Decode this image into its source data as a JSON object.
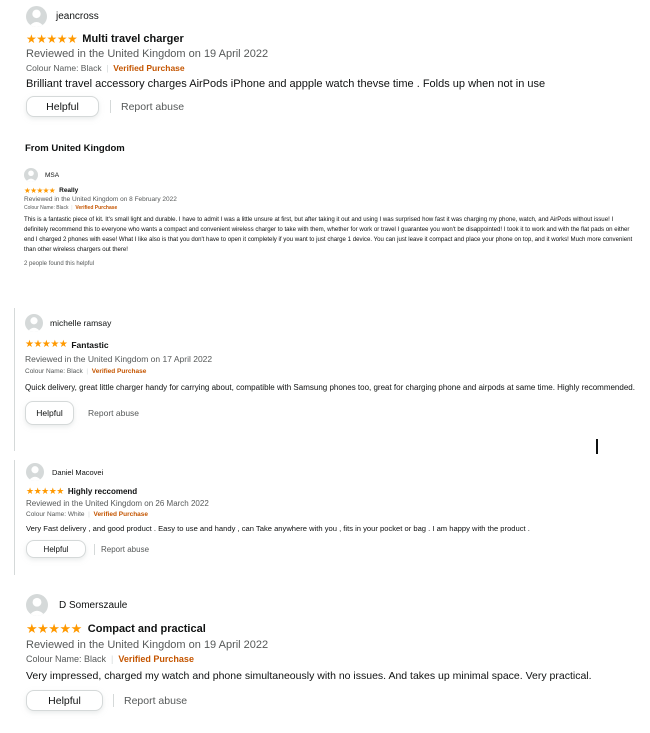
{
  "reviews": [
    {
      "reviewer": "jeancross",
      "stars": "★★★★★",
      "title": "Multi travel charger",
      "reviewed": "Reviewed in the United Kingdom on 19 April 2022",
      "variant": "Colour Name: Black",
      "verified": "Verified Purchase",
      "body": "Brilliant travel accessory charges AirPods iPhone and appple watch thevse time . Folds up when not in use",
      "helpful_label": "Helpful",
      "report_label": "Report abuse"
    },
    {
      "reviewer": "MSA",
      "stars": "★★★★★",
      "title": "Really",
      "reviewed": "Reviewed in the United Kingdom on 8 February 2022",
      "variant": "Colour Name: Black",
      "verified": "Verified Purchase",
      "body": "This is a fantastic piece of kit. It's small light and durable. I have to admit I was a little unsure at first, but after taking it out and using I was surprised how fast it was charging my phone, watch, and AirPods without issue! I definitely recommend this to everyone who wants a compact and convenient wireless charger to take with them, whether for work or travel I guarantee you won't be disappointed! I took it to work and with the flat pads on either end I charged 2 phones with ease! What I like also is that you don't have to open it completely if you want to just charge 1 device. You can just leave it compact and place your phone on top, and it works! Much more convenient than other wireless chargers out there!",
      "helpful_count": "2 people found this helpful"
    },
    {
      "reviewer": "michelle ramsay",
      "stars": "★★★★★",
      "title": "Fantastic",
      "reviewed": "Reviewed in the United Kingdom on 17 April 2022",
      "variant": "Colour Name: Black",
      "verified": "Verified Purchase",
      "body": "Quick delivery, great little charger handy for carrying about, compatible with Samsung phones too, great for charging phone and airpods at same time. Highly recommended.",
      "helpful_label": "Helpful",
      "report_label": "Report abuse"
    },
    {
      "reviewer": "Daniel Macovei",
      "stars": "★★★★★",
      "title": "Highly reccomend",
      "reviewed": "Reviewed in the United Kingdom on 26 March 2022",
      "variant": "Colour Name: White",
      "verified": "Verified Purchase",
      "body": "Very Fast delivery , and good product . Easy to use and handy , can Take anywhere with you , fits in your pocket or bag . I am happy with the product .",
      "helpful_label": "Helpful",
      "report_label": "Report abuse"
    },
    {
      "reviewer": "D Somerszaule",
      "stars": "★★★★★",
      "title": "Compact and practical",
      "reviewed": "Reviewed in the United Kingdom on 19 April 2022",
      "variant": "Colour Name: Black",
      "verified": "Verified Purchase",
      "body": "Very impressed, charged my watch and phone simultaneously with no issues. And takes up minimal space. Very practical.",
      "helpful_label": "Helpful",
      "report_label": "Report abuse"
    }
  ],
  "section_heading": "From United Kingdom",
  "colors": {
    "star": "#ff9900",
    "verified": "#c45500",
    "meta": "#565959",
    "text": "#0f1111",
    "border": "#d5d9d9"
  }
}
